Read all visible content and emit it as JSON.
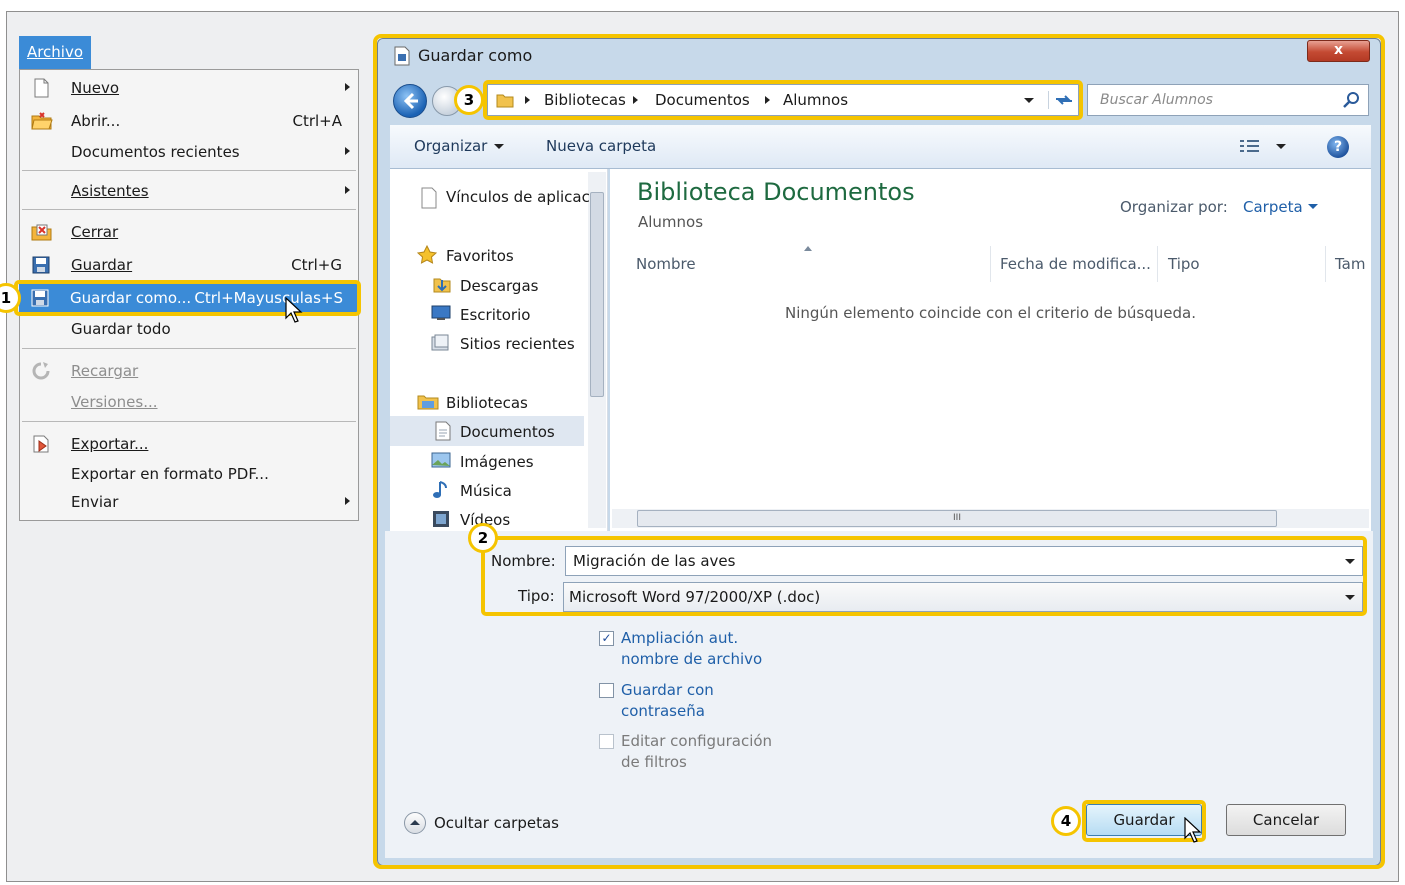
{
  "menu": {
    "title": "Archivo",
    "items": [
      {
        "label": "Nuevo",
        "shortcut": "",
        "submenu": true
      },
      {
        "label": "Abrir...",
        "shortcut": "Ctrl+A"
      },
      {
        "label": "Documentos recientes",
        "submenu": true
      },
      {
        "label": "Asistentes",
        "submenu": true
      },
      {
        "label": "Cerrar"
      },
      {
        "label": "Guardar",
        "shortcut": "Ctrl+G"
      },
      {
        "label": "Guardar como...",
        "shortcut": "Ctrl+Mayusculas+S"
      },
      {
        "label": "Guardar todo"
      },
      {
        "label": "Recargar",
        "disabled": true
      },
      {
        "label": "Versiones...",
        "disabled": true
      },
      {
        "label": "Exportar..."
      },
      {
        "label": "Exportar en formato PDF..."
      },
      {
        "label": "Enviar",
        "submenu": true
      }
    ]
  },
  "callouts": [
    "1",
    "2",
    "3",
    "4"
  ],
  "dialog": {
    "title": "Guardar como",
    "close_label": "x",
    "breadcrumb": [
      "Bibliotecas",
      "Documentos",
      "Alumnos"
    ],
    "search_placeholder": "Buscar Alumnos",
    "toolbar": {
      "organize": "Organizar",
      "new_folder": "Nueva carpeta"
    },
    "nav": {
      "items": [
        "Vínculos de aplicac",
        "Favoritos",
        "Descargas",
        "Escritorio",
        "Sitios recientes",
        "Bibliotecas",
        "Documentos",
        "Imágenes",
        "Música",
        "Vídeos"
      ]
    },
    "content": {
      "library_title": "Biblioteca Documentos",
      "library_subtitle": "Alumnos",
      "arrange_label": "Organizar por:",
      "arrange_value": "Carpeta",
      "columns": [
        "Nombre",
        "Fecha de modifica...",
        "Tipo",
        "Tam"
      ],
      "empty_message": "Ningún elemento coincide con el criterio de búsqueda."
    },
    "filename_label": "Nombre:",
    "filename_value": "Migración de las aves",
    "type_label": "Tipo:",
    "type_value": "Microsoft Word 97/2000/XP (.doc)",
    "options": [
      {
        "label_1": "Ampliación aut.",
        "label_2": "nombre de archivo",
        "checked": true,
        "disabled": false
      },
      {
        "label_1": "Guardar con",
        "label_2": "contraseña",
        "checked": false,
        "disabled": false
      },
      {
        "label_1": "Editar configuración",
        "label_2": "de filtros",
        "checked": false,
        "disabled": true
      }
    ],
    "hide_folders_label": "Ocultar carpetas",
    "save_label": "Guardar",
    "cancel_label": "Cancelar"
  },
  "colors": {
    "highlight": "#3b8bd7",
    "callout": "#f5c400",
    "link": "#1f5fa8"
  }
}
